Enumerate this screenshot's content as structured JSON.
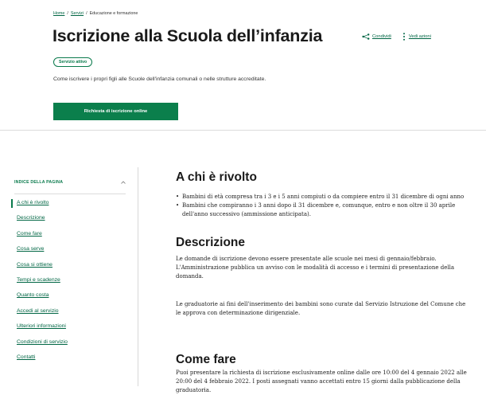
{
  "breadcrumb": {
    "items": [
      "Home",
      "Servizi",
      "Educazione e formazione"
    ],
    "separator": "/"
  },
  "header": {
    "title": "Iscrizione alla Scuola dell’infanzia",
    "share_label": "Condividi",
    "actions_label": "Vedi azioni",
    "status_badge": "Servizio attivo",
    "subtitle": "Come iscrivere i propri figli alle Scuole dell'infanzia comunali o nelle strutture accreditate.",
    "cta_label": "Richiesta di iscrizione online"
  },
  "toc": {
    "title": "INDICE DELLA PAGINA",
    "items": [
      "A chi è rivolto",
      "Descrizione",
      "Come fare",
      "Cosa serve",
      "Cosa si ottiene",
      "Tempi e scadenze",
      "Quanto costa",
      "Accedi al servizio",
      "Ulteriori informazioni",
      "Condizioni di servizio",
      "Contatti"
    ],
    "active_index": 0
  },
  "sections": {
    "a_chi": {
      "heading": "A chi è rivolto",
      "bullets": [
        "Bambini di età compresa tra i 3 e i 5 anni compiuti o da compiere entro il 31 dicembre di ogni anno",
        "Bambini che compiranno i 3 anni dopo il 31 dicembre e, comunque, entro e non oltre il 30 aprile",
        "dell'anno successivo (ammissione anticipata)."
      ]
    },
    "descrizione": {
      "heading": "Descrizione",
      "p1_lines": [
        "Le domande di iscrizione devono essere presentate alle scuole nei mesi di gennaio/febbraio.",
        "L'Amministrazione pubblica un avviso con le modalità di accesso e i termini di presentazione della",
        "domanda."
      ],
      "p2_lines": [
        "Le graduatorie ai fini dell'inserimento dei bambini sono curate dal Servizio Istruzione del Comune che",
        "le approva con determinazione dirigenziale."
      ]
    },
    "come_fare": {
      "heading": "Come fare",
      "p1_lines": [
        "Puoi presentare la richiesta di iscrizione esclusivamente online dalle ore 10:00 del 4 gennaio 2022 alle",
        "20:00 del 4 febbraio 2022. I posti assegnati vanno accettati entro 15 giorni dalla pubblicazione della",
        "graduatoria."
      ]
    }
  },
  "colors": {
    "primary": "#0b7f4c",
    "link": "#006644",
    "text": "#1a1a1a"
  }
}
